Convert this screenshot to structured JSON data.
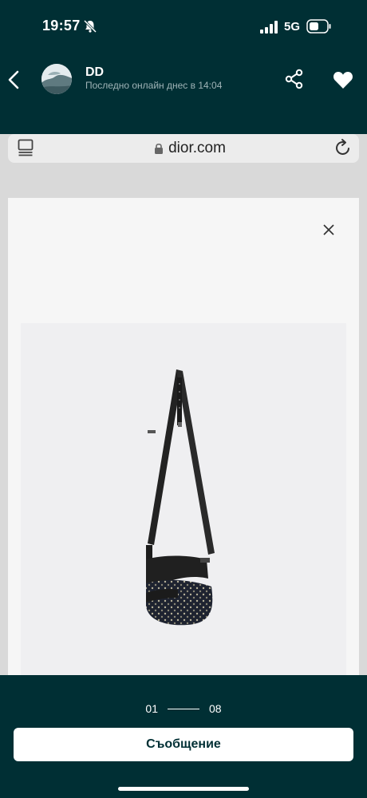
{
  "status_bar": {
    "time": "19:57",
    "network": "5G",
    "icons": [
      "bell-muted-icon",
      "signal-icon",
      "battery-icon"
    ]
  },
  "header": {
    "contact_name": "DD",
    "contact_status": "Последно онлайн днес в 14:04",
    "icons": [
      "back-icon",
      "share-icon",
      "heart-icon"
    ]
  },
  "browser": {
    "url": "dior.com",
    "icons": [
      "tabs-icon",
      "lock-icon",
      "reload-icon"
    ]
  },
  "viewer": {
    "close_icon": "close-icon",
    "current_page": "01",
    "total_pages": "08"
  },
  "actions": {
    "message_label": "Съобщение"
  },
  "colors": {
    "background": "#002f34",
    "button": "#ffffff",
    "button_text": "#002f34"
  }
}
